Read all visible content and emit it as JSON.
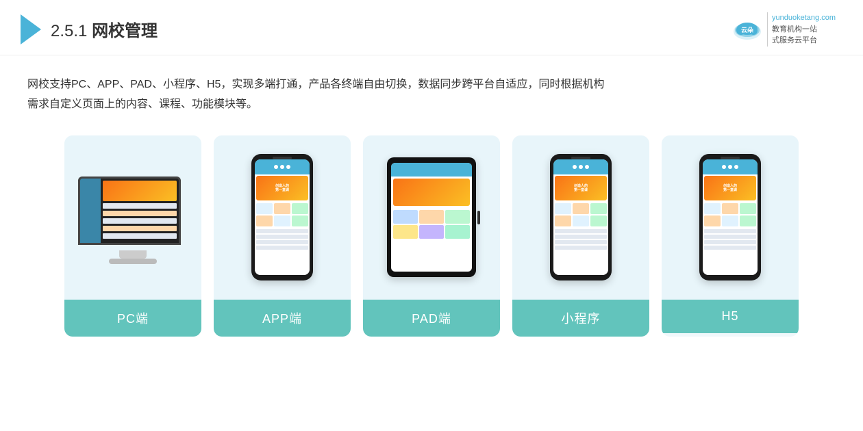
{
  "header": {
    "section_num": "2.5.1",
    "title_suffix": "网校管理",
    "logo_url": "yunduoketang.com",
    "brand_line1": "教育机构一站",
    "brand_line2": "式服务云平台"
  },
  "description": {
    "line1": "网校支持PC、APP、PAD、小程序、H5，实现多端打通，产品各终端自由切换，数据同步跨平台自适应，同时根据机构",
    "line2": "需求自定义页面上的内容、课程、功能模块等。"
  },
  "cards": [
    {
      "id": "pc",
      "label": "PC端",
      "type": "pc"
    },
    {
      "id": "app",
      "label": "APP端",
      "type": "phone"
    },
    {
      "id": "pad",
      "label": "PAD端",
      "type": "tablet"
    },
    {
      "id": "mini",
      "label": "小程序",
      "type": "phone"
    },
    {
      "id": "h5",
      "label": "H5",
      "type": "phone"
    }
  ]
}
